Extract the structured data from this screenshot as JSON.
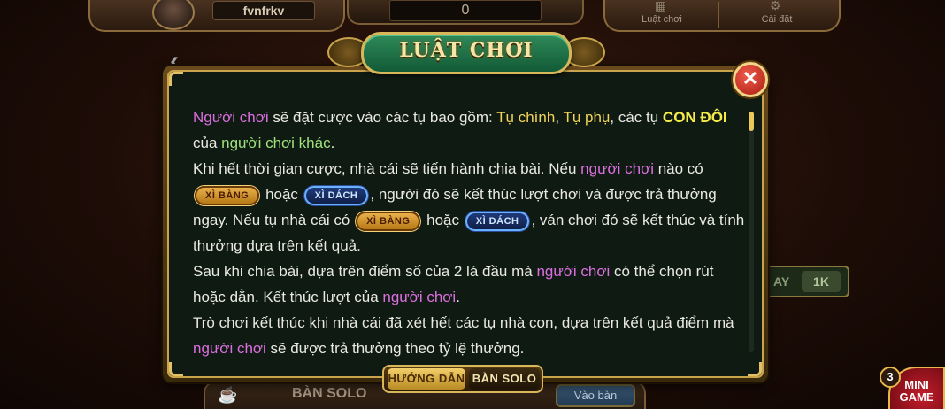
{
  "background": {
    "username": "fvnfrkv",
    "balance": "0",
    "top_buttons": [
      {
        "label": "Luật chơi",
        "icon": "rules-icon"
      },
      {
        "label": "Cài đặt",
        "icon": "gear-icon"
      }
    ],
    "bet_chip": {
      "prefix": "AY",
      "value": "1K"
    },
    "bottom_label": "BÀN SOLO",
    "join_button": "Vào bàn",
    "mini_game": {
      "badge": "3",
      "line1": "MINI",
      "line2": "GAME"
    }
  },
  "dialog": {
    "title": "LUẬT CHƠI",
    "close_icon": "close-icon",
    "paragraphs": {
      "p1": {
        "t1": "Người chơi",
        "t2": " sẽ đặt cược vào các tụ bao gồm: ",
        "t3": "Tụ chính",
        "t4": ", ",
        "t5": "Tụ phụ",
        "t6": ", các tụ ",
        "t7": "CON ĐÔI",
        "t8": " của ",
        "t9": "người chơi khác",
        "t10": "."
      },
      "p2": {
        "t1": "Khi hết thời gian cược, nhà cái sẽ tiến hành chia bài. Nếu ",
        "t2": "người chơi",
        "t3": " nào có ",
        "b1": "XÌ BÀNG",
        "t4": " hoặc ",
        "b2": "XÌ DÁCH",
        "t5": ", người đó sẽ kết thúc lượt chơi và được trả thưởng ngay. Nếu tụ nhà cái có ",
        "b3": "XÌ BÀNG",
        "t6": " hoặc ",
        "b4": "XÌ DÁCH",
        "t7": ", ván chơi đó sẽ kết thúc và tính thưởng dựa trên kết quả."
      },
      "p3": {
        "t1": "Sau khi chia bài, dựa trên điểm số của 2 lá đầu mà ",
        "t2": "người chơi",
        "t3": " có thể chọn rút hoặc dằn. Kết thúc lượt của ",
        "t4": "người chơi",
        "t5": "."
      },
      "p4": {
        "t1": "Trò chơi kết thúc khi nhà cái đã xét hết các tụ nhà con, dựa trên kết quả điểm mà ",
        "t2": "người chơi",
        "t3": " sẽ được trả thưởng theo tỷ lệ thưởng."
      }
    },
    "tabs": [
      {
        "label": "HƯỚNG DẪN",
        "active": true
      },
      {
        "label": "BÀN SOLO",
        "active": false
      }
    ],
    "colors": {
      "highlight_pink": "#dc6fe0",
      "highlight_gold": "#f2d45a",
      "highlight_green": "#9fe27b",
      "highlight_bold": "#f5ec4a"
    }
  }
}
